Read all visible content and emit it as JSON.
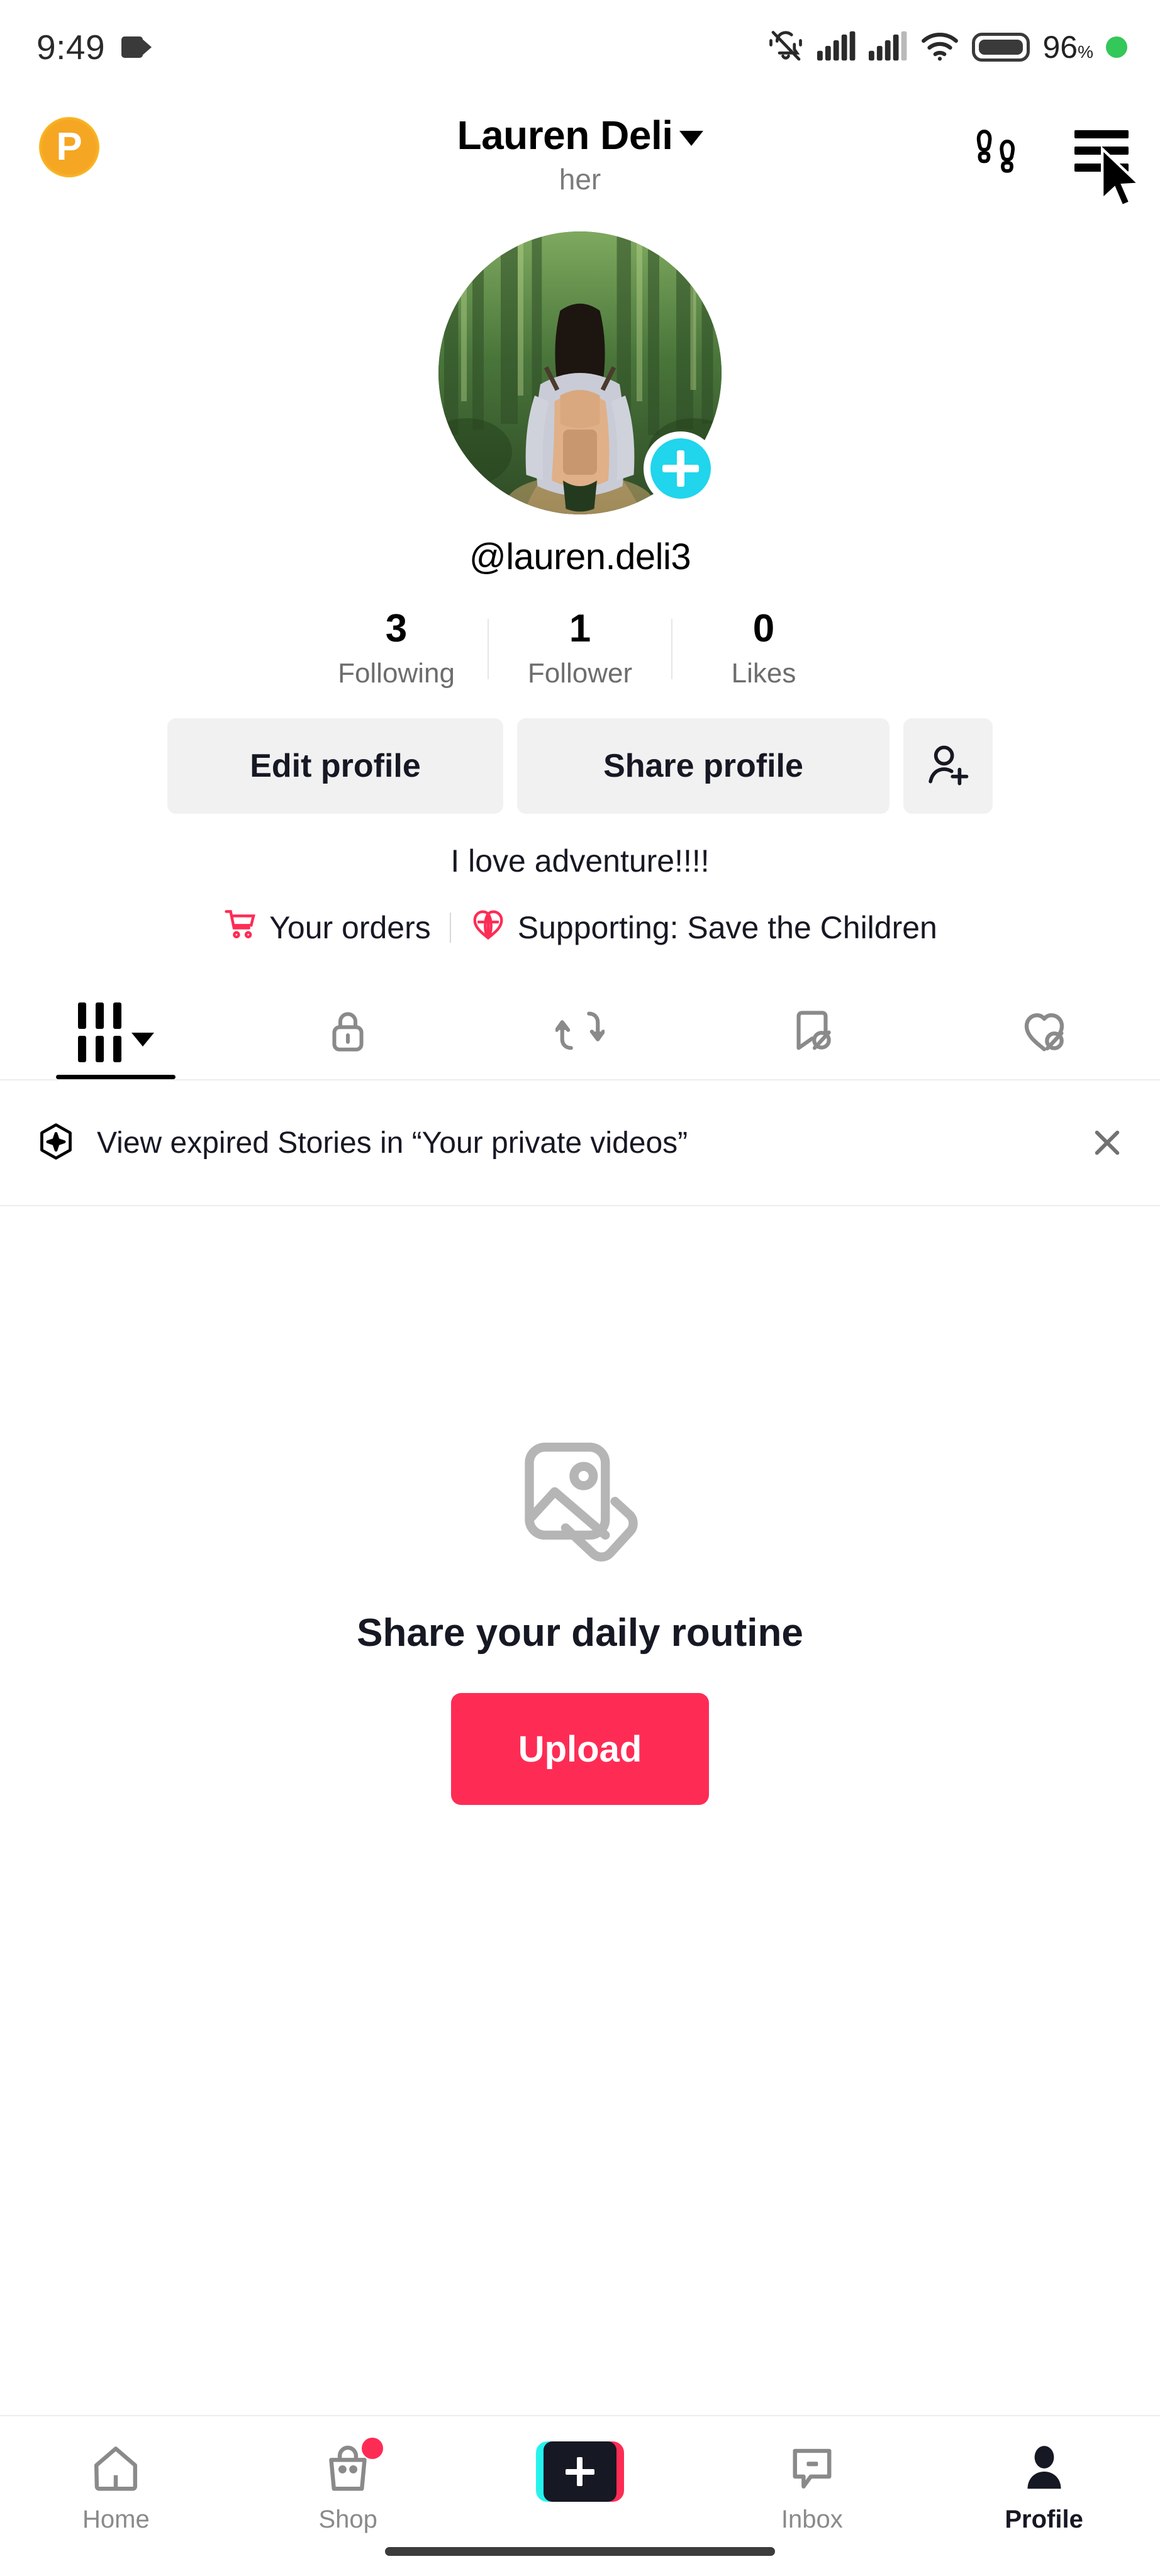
{
  "status_bar": {
    "time": "9:49",
    "video_icon": "video-camera-icon",
    "mute_icon": "bell-muted-icon",
    "signal_icons": [
      "signal-bars-icon",
      "signal-bars-icon"
    ],
    "wifi_icon": "wifi-icon",
    "battery_icon": "battery-icon",
    "battery_percent": "96",
    "battery_percent_symbol": "%",
    "recording_dot": "green-dot-icon"
  },
  "header": {
    "left_badge_letter": "P",
    "left_badge_name": "points-badge",
    "display_name": "Lauren Deli",
    "dropdown_icon": "chevron-down-icon",
    "pronouns": "her",
    "footprints_icon": "footprints-icon",
    "menu_icon": "hamburger-menu-icon",
    "cursor_icon": "mouse-cursor-icon"
  },
  "profile": {
    "avatar_alt": "hiker-with-backpack-in-forest",
    "avatar_add_icon": "plus-badge-icon",
    "handle": "@lauren.deli3",
    "bio": "I love adventure!!!!"
  },
  "stats": [
    {
      "count": "3",
      "label": "Following"
    },
    {
      "count": "1",
      "label": "Follower"
    },
    {
      "count": "0",
      "label": "Likes"
    }
  ],
  "actions": {
    "edit_profile": "Edit profile",
    "share_profile": "Share profile",
    "add_friends_icon": "person-add-icon"
  },
  "links": {
    "orders_icon": "shopping-cart-icon",
    "orders_label": "Your orders",
    "supporting_icon": "charity-heart-globe-icon",
    "supporting_label": "Supporting: Save the Children"
  },
  "tabs": [
    {
      "name": "posts-tab",
      "icon": "grid-posts-icon",
      "active": true,
      "has_caret": true
    },
    {
      "name": "private-tab",
      "icon": "lock-icon",
      "active": false,
      "has_caret": false
    },
    {
      "name": "reposts-tab",
      "icon": "repost-arrows-icon",
      "active": false,
      "has_caret": false
    },
    {
      "name": "saved-tab",
      "icon": "bookmark-hidden-icon",
      "active": false,
      "has_caret": false
    },
    {
      "name": "liked-tab",
      "icon": "heart-hidden-icon",
      "active": false,
      "has_caret": false
    }
  ],
  "banner": {
    "icon": "story-sparkle-icon",
    "text": "View expired Stories in “Your private videos”",
    "close_icon": "close-icon"
  },
  "empty_state": {
    "icon": "stacked-photos-icon",
    "title": "Share your daily routine",
    "button_label": "Upload"
  },
  "bottom_nav": [
    {
      "label": "Home",
      "icon": "home-icon",
      "active": false,
      "badge": false
    },
    {
      "label": "Shop",
      "icon": "shop-bag-icon",
      "active": false,
      "badge": true
    },
    {
      "label": "",
      "icon": "create-plus-icon",
      "active": false,
      "badge": false
    },
    {
      "label": "Inbox",
      "icon": "inbox-message-icon",
      "active": false,
      "badge": false
    },
    {
      "label": "Profile",
      "icon": "person-icon",
      "active": true,
      "badge": false
    }
  ],
  "colors": {
    "accent_pink": "#FE2C55",
    "accent_cyan": "#25F4EE",
    "badge_orange": "#F5A623",
    "grey_button": "#F1F1F2",
    "text_dark": "#161823",
    "text_muted": "#6D6D6D"
  }
}
